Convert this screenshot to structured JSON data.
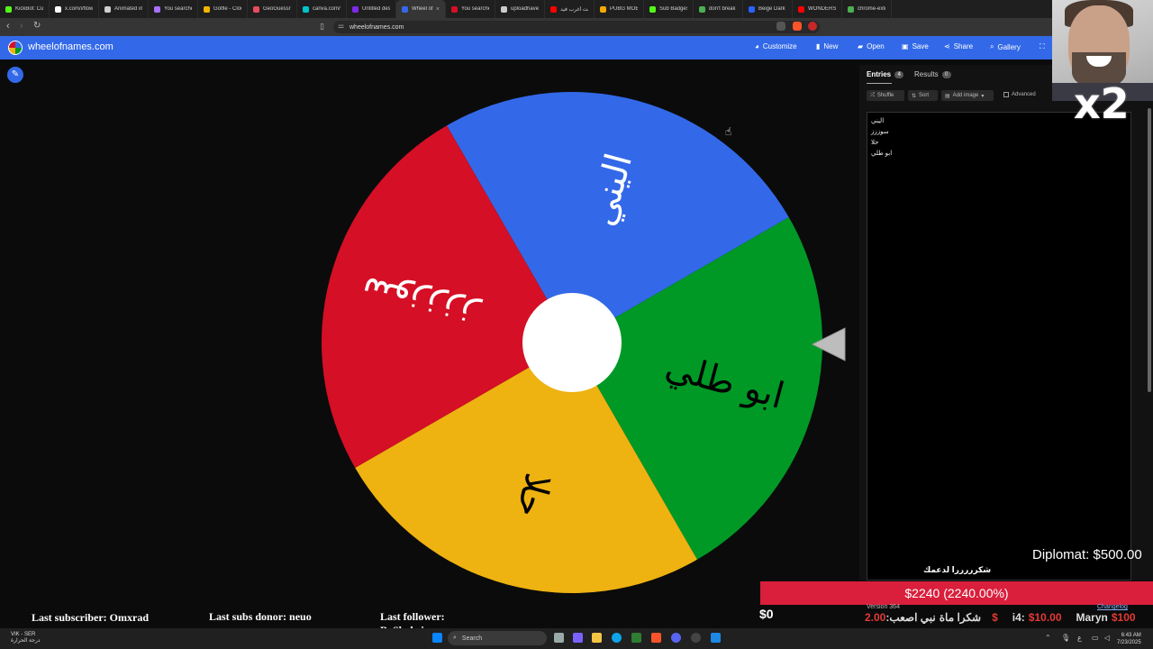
{
  "browser": {
    "tabs": [
      {
        "title": "KickBot: Custom",
        "color": "#53fc18"
      },
      {
        "title": "x.com/i/flow/k",
        "color": "#ffffff"
      },
      {
        "title": "Animated imag",
        "color": "#d0d0d0"
      },
      {
        "title": "You searched f",
        "color": "#a970ff"
      },
      {
        "title": "Golfle - Cloud",
        "color": "#f4b400"
      },
      {
        "title": "GeoGuessr Fre",
        "color": "#e84a5f"
      },
      {
        "title": "canva.com/vid",
        "color": "#00c4cc"
      },
      {
        "title": "Untitled desig",
        "color": "#7d2ae8"
      },
      {
        "title": "Wheel of",
        "color": "#3369e8",
        "active": true
      },
      {
        "title": "You searched f",
        "color": "#d50f25"
      },
      {
        "title": "uploadhaven.c",
        "color": "#cccccc"
      },
      {
        "title": "جربت أغرب فيد",
        "color": "#ff0000"
      },
      {
        "title": "PUBG MOBILE",
        "color": "#f2a900"
      },
      {
        "title": "Sub Badges -",
        "color": "#53fc18"
      },
      {
        "title": "don't break my",
        "color": "#4caf50"
      },
      {
        "title": "Beige Dark Gre",
        "color": "#2962ff"
      },
      {
        "title": "WONDERS OF",
        "color": "#ff0000"
      },
      {
        "title": "chrome-extens",
        "color": "#4caf50"
      }
    ],
    "url": "wheelofnames.com"
  },
  "header": {
    "site_title": "wheelofnames.com",
    "buttons": {
      "customize": "Customize",
      "new": "New",
      "open": "Open",
      "save": "Save",
      "share": "Share",
      "gallery": "Gallery"
    }
  },
  "wheel": {
    "segments": [
      {
        "label": "اليني",
        "color": "#3369e8"
      },
      {
        "label": "ابو طلي",
        "color": "#009925"
      },
      {
        "label": "حلا",
        "color": "#eeb211"
      },
      {
        "label": "سوزززز",
        "color": "#d50f25"
      }
    ]
  },
  "panel": {
    "tabs": {
      "entries_label": "Entries",
      "entries_count": "4",
      "results_label": "Results",
      "results_count": "0"
    },
    "toolbar": {
      "shuffle": "Shuffle",
      "sort": "Sort",
      "add_image": "Add image",
      "advanced": "Advanced"
    },
    "entries": [
      "اليني",
      "سوززز",
      "حلا",
      "ابو طلي"
    ],
    "version": "Version 364",
    "changelog": "Changelog"
  },
  "overlay": {
    "x2": "x2",
    "diplomat": "Diplomat: $500.00",
    "thanks": "شكرررررا لدعمك",
    "goal": "$2240 (2240.00%)",
    "zero": "$0",
    "last_subscriber": "Last subscriber: Omxrad",
    "last_subs_donor": "Last subs donor: neuo",
    "last_follower": "Last follower: BoShahri",
    "donors": [
      {
        "name": "شكرا ماة",
        "amount": ""
      },
      {
        "name": "نبي اصعب:",
        "amount": "2.00$"
      },
      {
        "name": "i4:",
        "amount": "$10.00"
      },
      {
        "name": "Maryn",
        "amount": "$100"
      }
    ]
  },
  "taskbar": {
    "weather_line1": "VIK - SER",
    "weather_line2": "درجة الحرارة",
    "search": "Search",
    "time": "6:43 AM",
    "date": "7/23/2025"
  }
}
